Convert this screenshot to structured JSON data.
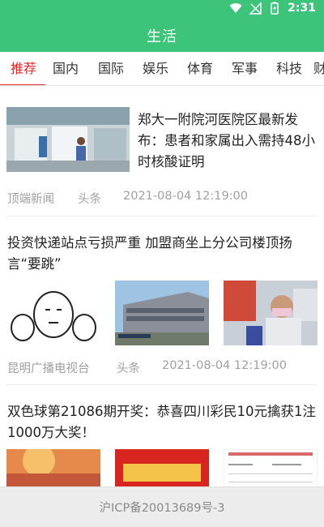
{
  "status_bar": {
    "time": "2:31",
    "icons": [
      "wifi-icon",
      "no-signal-icon",
      "battery-icon"
    ]
  },
  "app_bar": {
    "title": "生活"
  },
  "tabs": [
    {
      "label": "推荐",
      "active": true
    },
    {
      "label": "国内",
      "active": false
    },
    {
      "label": "国际",
      "active": false
    },
    {
      "label": "娱乐",
      "active": false
    },
    {
      "label": "体育",
      "active": false
    },
    {
      "label": "军事",
      "active": false
    },
    {
      "label": "科技",
      "active": false
    },
    {
      "label": "财",
      "active": false
    }
  ],
  "news": [
    {
      "title": "郑大一附院河医院区最新发布：患者和家属出入需持48小时核酸证明",
      "source": "顶端新闻",
      "tag": "头条",
      "time": "2021-08-04 12:19:00"
    },
    {
      "title": "投资快递站点亏损严重 加盟商坐上分公司楼顶扬言“要跳”",
      "source": "昆明广播电视台",
      "tag": "头条",
      "time": "2021-08-04 12:19:00"
    },
    {
      "title": "双色球第21086期开奖：恭喜四川彩民10元擒获1注1000万大奖！",
      "source": "",
      "tag": "",
      "time": ""
    }
  ],
  "footer": {
    "icp": "沪ICP备20013689号-3"
  },
  "colors": {
    "brand_green": "#3cc47a",
    "active_tab_red": "#e02a2a",
    "meta_gray": "#a0a0a0"
  }
}
